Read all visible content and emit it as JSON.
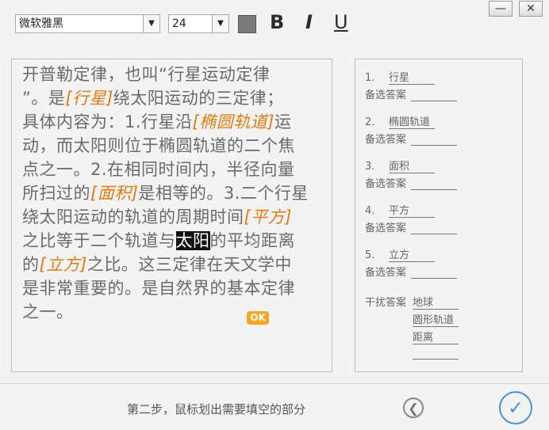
{
  "toolbar": {
    "font_name": "微软雅黑",
    "font_size": "24",
    "bold_label": "B",
    "italic_label": "I",
    "underline_label": "U",
    "color": "#7b7b7b"
  },
  "window": {
    "minimize": "—",
    "close": "✕"
  },
  "editor": {
    "p1": "开普勒定律，也叫“行星运动定律",
    "p2a": "”。是",
    "b1": "[行星]",
    "p2b": "绕太阳运动的三定律；",
    "p3a": "具体内容为：1.行星沿",
    "b2": "[椭圆轨道]",
    "p3b": "运",
    "p4": "动，而太阳则位于椭圆轨道的二个焦",
    "p5": "点之一。2.在相同时间内，半径向量",
    "p6a": "所扫过的",
    "b3": "[面积]",
    "p6b": "是相等的。3.二个行星",
    "p7a": "绕太阳运动的轨道的周期时间",
    "b4": "[平方]",
    "p8a": "之比等于二个轨道与",
    "selected": "太阳",
    "p8b": "的平均距离",
    "p9a": "的",
    "b5": "[立方]",
    "p9b": "之比。这三定律在天文学中",
    "p10": "是非常重要的。是自然界的基本定律",
    "p11": "之一。",
    "ok_badge": "OK"
  },
  "answers": {
    "items": [
      {
        "num": "1.",
        "answer": "行星"
      },
      {
        "num": "2.",
        "answer": "椭圆轨道"
      },
      {
        "num": "3.",
        "answer": "面积"
      },
      {
        "num": "4.",
        "answer": "平方"
      },
      {
        "num": "5.",
        "answer": "立方"
      }
    ],
    "alt_label": "备选答案",
    "distractor_label": "干扰答案",
    "distractors": [
      "地球",
      "圆形轨道",
      "距离",
      ""
    ]
  },
  "footer": {
    "status": "第二步，鼠标划出需要填空的部分"
  }
}
